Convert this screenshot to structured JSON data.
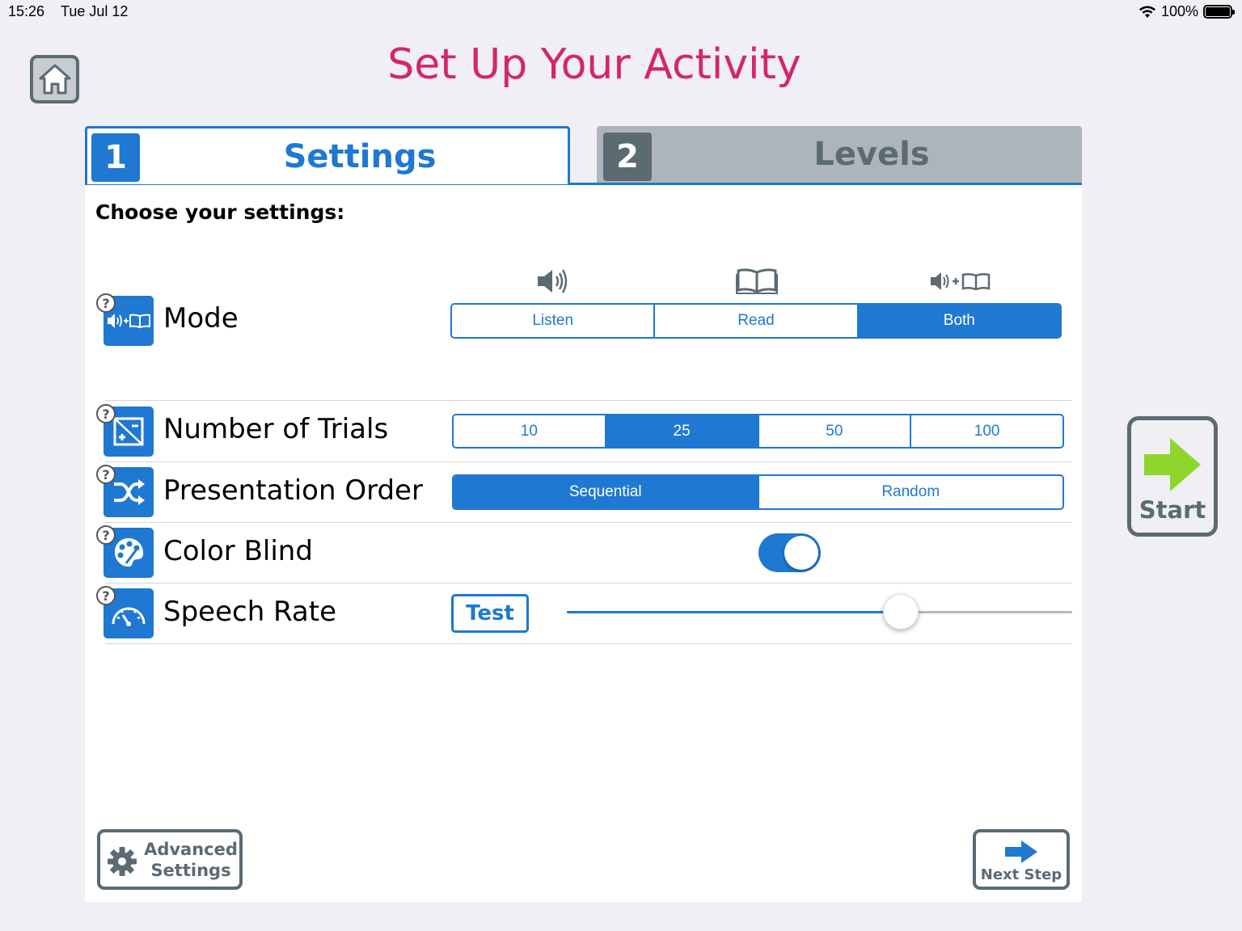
{
  "status_bar": {
    "time": "15:26",
    "date": "Tue Jul 12",
    "battery": "100%"
  },
  "page_title": "Set Up Your Activity",
  "tabs": [
    {
      "number": "1",
      "label": "Settings",
      "active": true
    },
    {
      "number": "2",
      "label": "Levels",
      "active": false
    }
  ],
  "prompt": "Choose your settings:",
  "help_glyph": "?",
  "settings": {
    "mode": {
      "label": "Mode",
      "options": [
        "Listen",
        "Read",
        "Both"
      ],
      "selected": "Both"
    },
    "trials": {
      "label": "Number of Trials",
      "options": [
        "10",
        "25",
        "50",
        "100"
      ],
      "selected": "25"
    },
    "order": {
      "label": "Presentation Order",
      "options": [
        "Sequential",
        "Random"
      ],
      "selected": "Sequential"
    },
    "color_blind": {
      "label": "Color Blind",
      "on": true
    },
    "speech_rate": {
      "label": "Speech Rate",
      "test_label": "Test",
      "value_fraction": 0.66
    }
  },
  "start_label": "Start",
  "advanced_label_line1": "Advanced",
  "advanced_label_line2": "Settings",
  "next_step_label": "Next Step",
  "colors": {
    "primary": "#1f78d1",
    "title": "#d4256d",
    "gray": "#5c6a72",
    "start_arrow": "#8ed62b"
  },
  "icons": [
    "home-icon",
    "speaker-icon",
    "book-icon",
    "gear-icon",
    "arrow-right-icon",
    "shuffle-icon",
    "palette-icon",
    "gauge-icon",
    "wifi-icon",
    "battery-icon"
  ]
}
